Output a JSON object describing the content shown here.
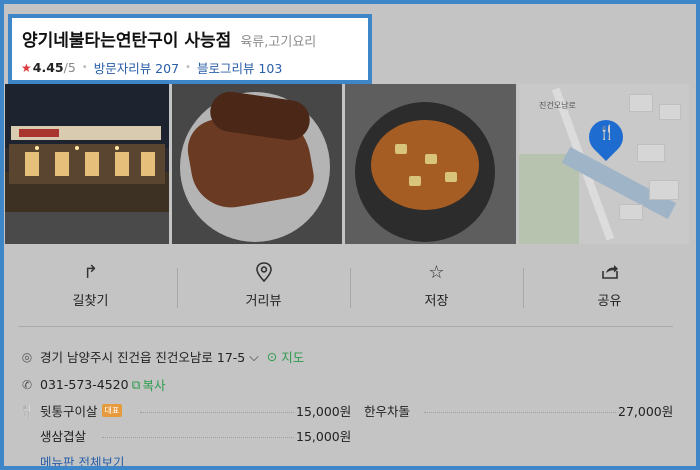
{
  "place": {
    "name": "양기네불타는연탄구이 사능점",
    "category": "육류,고기요리",
    "rating": "4.45",
    "rating_max": "/5",
    "visitor_reviews": "방문자리뷰 207",
    "blog_reviews": "블로그리뷰 103"
  },
  "map": {
    "road_label": "진건오남로"
  },
  "actions": [
    {
      "label": "길찾기",
      "icon": "directions-icon"
    },
    {
      "label": "거리뷰",
      "icon": "street-view-icon"
    },
    {
      "label": "저장",
      "icon": "star-outline-icon"
    },
    {
      "label": "공유",
      "icon": "share-icon"
    }
  ],
  "info": {
    "address": "경기 남양주시 진건읍 진건오남로 17-5",
    "map_link": "지도",
    "phone": "031-573-4520",
    "copy_label": "복사"
  },
  "menu": {
    "items": [
      {
        "name": "뒷통구이살",
        "badge": "대표",
        "price": "15,000원"
      },
      {
        "name": "한우차돌",
        "price": "27,000원"
      },
      {
        "name": "생삼겹살",
        "price": "15,000원"
      }
    ],
    "more_label": "메뉴판 전체보기"
  },
  "colors": {
    "accent": "#3f86c9",
    "link": "#2a5ea8",
    "green": "#2e9b4e",
    "star": "#e0393e"
  }
}
